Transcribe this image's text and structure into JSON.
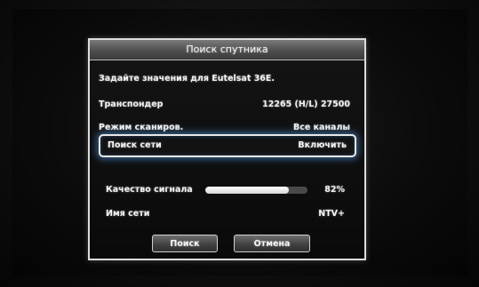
{
  "dialog": {
    "title": "Поиск спутника",
    "prompt": "Задайте значения для Eutelsat 36E.",
    "rows": [
      {
        "label": "Транспондер",
        "value": "12265 (H/L) 27500"
      },
      {
        "label": "Режим сканиров.",
        "value": "Все каналы"
      },
      {
        "label": "Поиск сети",
        "value": "Включить"
      }
    ],
    "signal": {
      "label": "Качество сигнала",
      "percent_text": "82%",
      "level": 0.82
    },
    "network": {
      "label": "Имя сети",
      "value": "NTV+"
    },
    "buttons": {
      "search": "Поиск",
      "cancel": "Отмена"
    }
  }
}
